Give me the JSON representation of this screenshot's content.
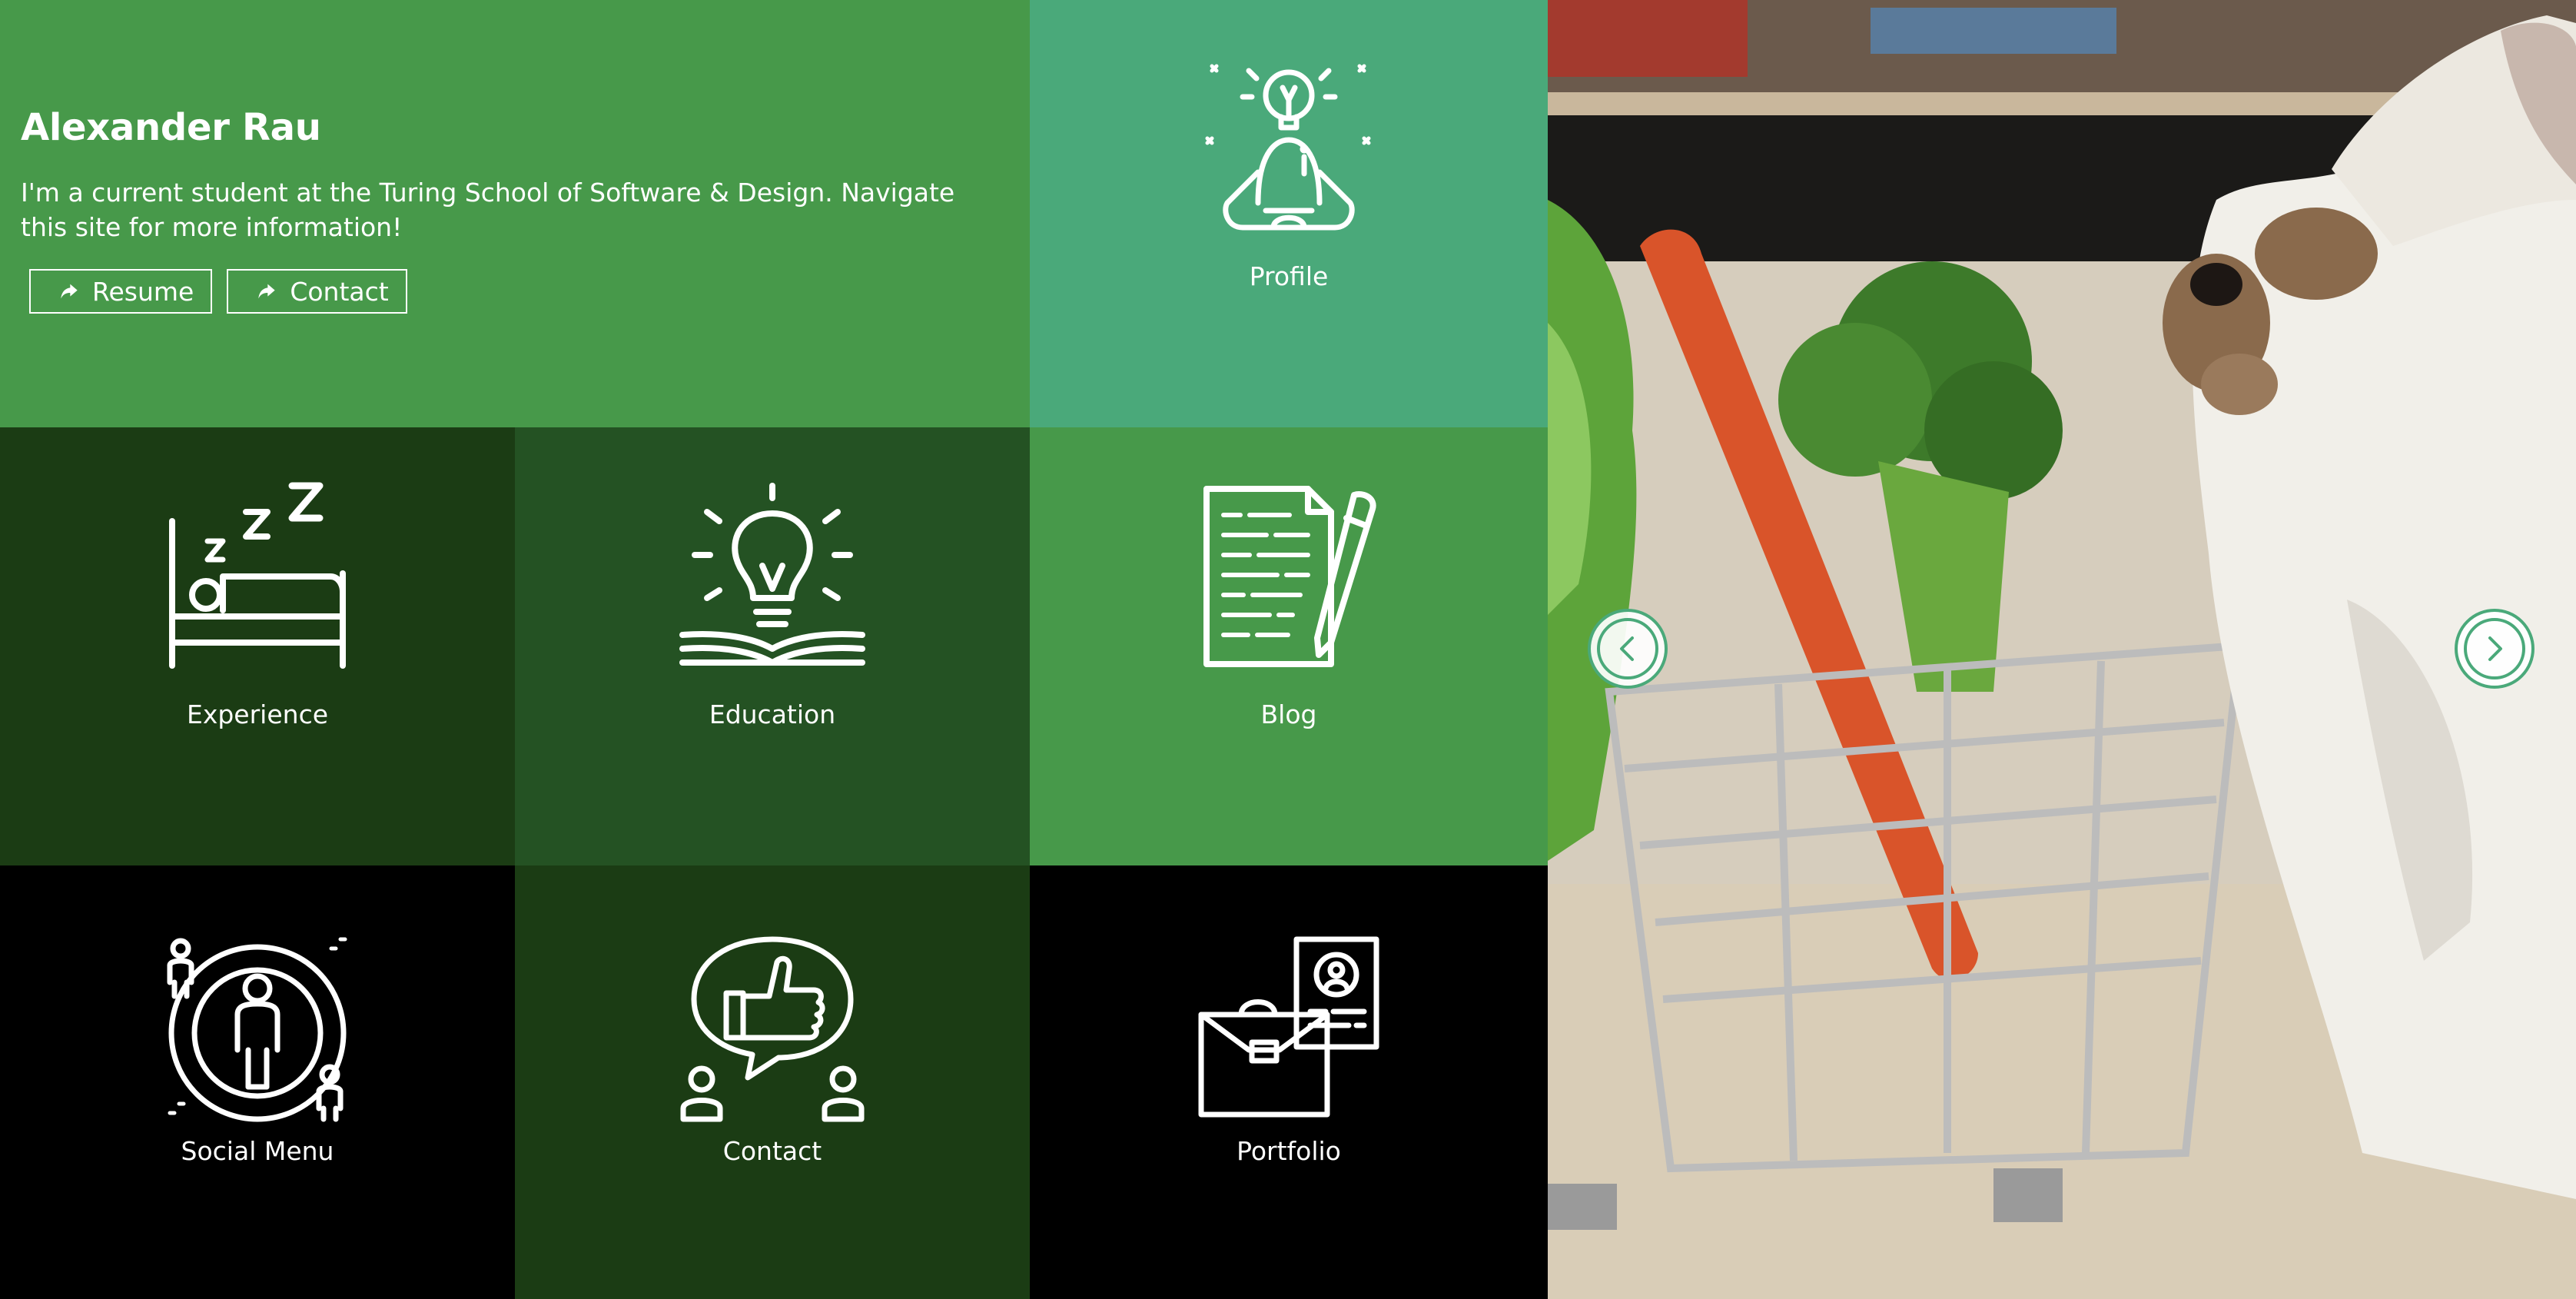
{
  "hero": {
    "name": "Alexander Rau",
    "description": "I'm a current student at the Turing School of Software & Design. Navigate this site for more information!",
    "buttons": [
      {
        "label": "Resume",
        "icon": "share-arrow-icon"
      },
      {
        "label": "Contact",
        "icon": "share-arrow-icon"
      }
    ]
  },
  "tiles": [
    {
      "label": "Profile",
      "icon": "meditating-lightbulb-person-icon",
      "color": "#4aa97a"
    },
    {
      "label": "Experience",
      "icon": "sleeping-bed-icon",
      "color": "#1b3c14"
    },
    {
      "label": "Education",
      "icon": "lightbulb-book-icon",
      "color": "#245223"
    },
    {
      "label": "Blog",
      "icon": "document-pencil-icon",
      "color": "#47994a"
    },
    {
      "label": "Social Menu",
      "icon": "people-network-icon",
      "color": "#000000"
    },
    {
      "label": "Contact",
      "icon": "thumbs-up-chat-icon",
      "color": "#1b3c14"
    },
    {
      "label": "Portfolio",
      "icon": "briefcase-id-card-icon",
      "color": "#000000"
    }
  ],
  "carousel": {
    "image": "rabbit-with-shopping-cart-photo",
    "prev_icon": "chevron-left-icon",
    "next_icon": "chevron-right-icon",
    "accent": "#4aa97a"
  },
  "colors": {
    "hero_green": "#47994a",
    "teal_green": "#4aa97a",
    "dark_green": "#1b3c14",
    "mid_dark_green": "#245223",
    "black": "#000000"
  }
}
